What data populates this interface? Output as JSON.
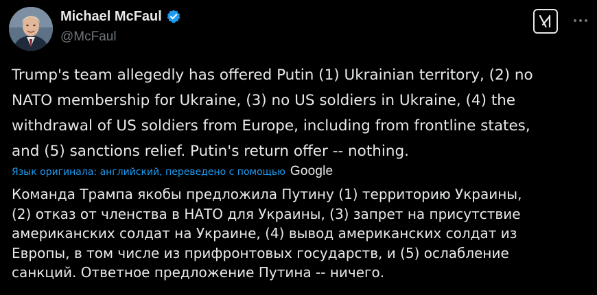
{
  "author": {
    "display_name": "Michael McFaul",
    "handle": "@McFaul",
    "verified_icon": "verified-badge-icon"
  },
  "header_actions": {
    "grok_icon": "grok-icon",
    "more_icon": "more-horizontal-icon"
  },
  "tweet": {
    "text": "Trump's team allegedly has offered Putin (1) Ukrainian territory, (2) no\nNATO membership for Ukraine, (3) no US soldiers in Ukraine, (4) the\nwithdrawal of US soldiers from Europe, including from frontline states,\nand (5) sanctions relief. Putin's return offer -- nothing."
  },
  "translation": {
    "note": "Язык оригинала: английский, переведено с помощью",
    "provider": "Google",
    "text": "Команда Трампа якобы предложила Путину (1) территорию Украины,\n(2) отказ от членства в НАТО для Украины, (3) запрет на присутствие\nамериканских солдат на Украине, (4) вывод американских солдат из\nЕвропы, в том числе из прифронтовых государств, и (5) ослабление\nсанкций. Ответное предложение Путина -- ничего."
  },
  "colors": {
    "background": "#000000",
    "text": "#e7e9ea",
    "secondary_text": "#71767b",
    "link": "#1d9bf0",
    "verified": "#1d9bf0"
  }
}
